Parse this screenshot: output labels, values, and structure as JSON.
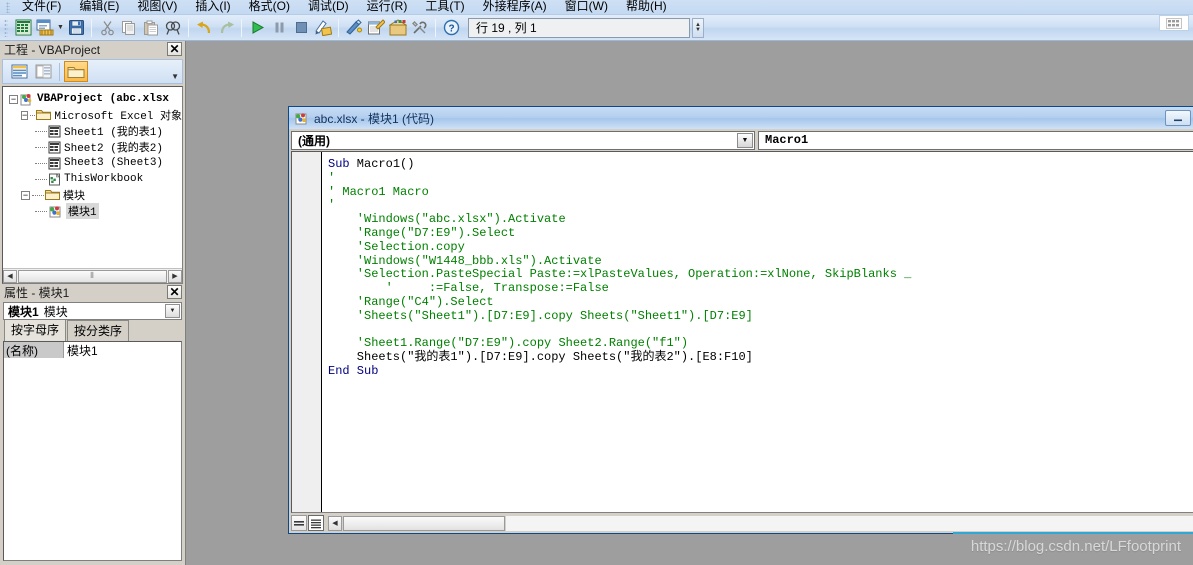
{
  "menu": {
    "items": [
      {
        "label": "文件(F)"
      },
      {
        "label": "编辑(E)"
      },
      {
        "label": "视图(V)"
      },
      {
        "label": "插入(I)"
      },
      {
        "label": "格式(O)"
      },
      {
        "label": "调试(D)"
      },
      {
        "label": "运行(R)"
      },
      {
        "label": "工具(T)"
      },
      {
        "label": "外接程序(A)"
      },
      {
        "label": "窗口(W)"
      },
      {
        "label": "帮助(H)"
      }
    ]
  },
  "toolbar": {
    "buttons": [
      {
        "name": "view-excel-icon",
        "title": "视图 Microsoft Excel"
      },
      {
        "name": "insert-userform-icon",
        "title": "插入"
      },
      {
        "name": "save-icon",
        "title": "保存"
      },
      {
        "name": "cut-icon",
        "title": "剪切"
      },
      {
        "name": "copy-icon",
        "title": "复制"
      },
      {
        "name": "paste-icon",
        "title": "粘贴"
      },
      {
        "name": "find-icon",
        "title": "查找"
      },
      {
        "name": "undo-icon",
        "title": "撤消"
      },
      {
        "name": "redo-icon",
        "title": "恢复"
      },
      {
        "name": "run-icon",
        "title": "运行子过程/用户窗体"
      },
      {
        "name": "pause-icon",
        "title": "中断"
      },
      {
        "name": "stop-icon",
        "title": "重新设置"
      },
      {
        "name": "design-mode-icon",
        "title": "设计模式"
      },
      {
        "name": "project-explorer-icon",
        "title": "工程资源管理器"
      },
      {
        "name": "properties-window-icon",
        "title": "属性窗口"
      },
      {
        "name": "object-browser-icon",
        "title": "对象浏览器"
      },
      {
        "name": "toolbox-icon",
        "title": "工具箱"
      },
      {
        "name": "help-icon",
        "title": "帮助"
      }
    ],
    "position_indicator": "行 19 , 列 1"
  },
  "project_panel": {
    "title": "工程 - VBAProject",
    "close_label": "✕",
    "toolbar_buttons": [
      {
        "name": "view-code-icon"
      },
      {
        "name": "view-object-icon"
      },
      {
        "name": "toggle-folders-icon"
      }
    ],
    "tree": [
      {
        "indent": 0,
        "expander": "-",
        "icon": "vbaproject-icon",
        "label": "VBAProject  (abc.xlsx",
        "selected": false
      },
      {
        "indent": 1,
        "expander": "-",
        "icon": "folder-icon",
        "label": "Microsoft Excel 对象",
        "selected": false
      },
      {
        "indent": 2,
        "expander": "",
        "icon": "sheet-icon",
        "label": "Sheet1 (我的表1)",
        "selected": false
      },
      {
        "indent": 2,
        "expander": "",
        "icon": "sheet-icon",
        "label": "Sheet2 (我的表2)",
        "selected": false
      },
      {
        "indent": 2,
        "expander": "",
        "icon": "sheet-icon",
        "label": "Sheet3 (Sheet3)",
        "selected": false
      },
      {
        "indent": 2,
        "expander": "",
        "icon": "workbook-icon",
        "label": "ThisWorkbook",
        "selected": false
      },
      {
        "indent": 1,
        "expander": "-",
        "icon": "folder-icon",
        "label": "模块",
        "selected": false
      },
      {
        "indent": 2,
        "expander": "",
        "icon": "module-icon",
        "label": "模块1",
        "selected": true
      }
    ],
    "hscroll_grip": "⦀"
  },
  "properties_panel": {
    "title": "属性 - 模块1",
    "close_label": "✕",
    "combo_bold": "模块1",
    "combo_rest": "模块",
    "tabs": [
      {
        "label": "按字母序",
        "active": true
      },
      {
        "label": "按分类序",
        "active": false
      }
    ],
    "rows": [
      {
        "name": "(名称)",
        "value": "模块1"
      }
    ]
  },
  "code_window": {
    "title": "abc.xlsx - 模块1 (代码)",
    "window_buttons": [
      {
        "name": "minimize-button",
        "glyph": "─"
      },
      {
        "name": "maximize-button",
        "glyph": "❐"
      }
    ],
    "object_combo": "(通用)",
    "procedure_combo": "Macro1",
    "combo_arrow_glyph": "▼",
    "code_lines": [
      {
        "type": "code",
        "text": "Sub Macro1()"
      },
      {
        "type": "comment",
        "text": "'"
      },
      {
        "type": "comment",
        "text": "' Macro1 Macro"
      },
      {
        "type": "comment",
        "text": "'"
      },
      {
        "type": "comment",
        "text": "    'Windows(\"abc.xlsx\").Activate"
      },
      {
        "type": "comment",
        "text": "    'Range(\"D7:E9\").Select"
      },
      {
        "type": "comment",
        "text": "    'Selection.copy"
      },
      {
        "type": "comment",
        "text": "    'Windows(\"W1448_bbb.xls\").Activate"
      },
      {
        "type": "comment",
        "text": "    'Selection.PasteSpecial Paste:=xlPasteValues, Operation:=xlNone, SkipBlanks _"
      },
      {
        "type": "comment",
        "text": "        '     :=False, Transpose:=False"
      },
      {
        "type": "comment",
        "text": "    'Range(\"C4\").Select"
      },
      {
        "type": "comment",
        "text": "    'Sheets(\"Sheet1\").[D7:E9].copy Sheets(\"Sheet1\").[D7:E9]"
      },
      {
        "type": "blank",
        "text": ""
      },
      {
        "type": "comment",
        "text": "    'Sheet1.Range(\"D7:E9\").copy Sheet2.Range(\"f1\")"
      },
      {
        "type": "code",
        "text": "    Sheets(\"我的表1\").[D7:E9].copy Sheets(\"我的表2\").[E8:F10]"
      },
      {
        "type": "code",
        "text": "End Sub"
      }
    ],
    "footer_buttons": [
      {
        "name": "procedure-view-button"
      },
      {
        "name": "full-module-view-button"
      }
    ]
  },
  "watermark": {
    "text": "https://blog.csdn.net/LFfootprint"
  },
  "colors": {
    "keyword": "#00007F",
    "comment": "#008000",
    "code_bg": "#FFFFFF",
    "chrome": "#D4D0C8",
    "mdi_bg": "#9E9E9E",
    "titlebar_accent": "#0A4A8C"
  }
}
